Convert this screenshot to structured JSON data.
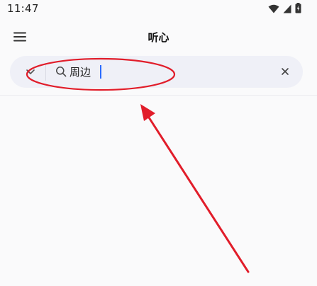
{
  "status_bar": {
    "time": "11:47",
    "icons": [
      "wifi-icon",
      "cellular-signal-icon",
      "battery-charging-icon"
    ]
  },
  "app_bar": {
    "title": "听心",
    "menu_icon": "hamburger-menu-icon"
  },
  "search": {
    "value": "周边",
    "left_icon": "chevron-down-icon",
    "search_icon": "search-icon",
    "clear_icon": "close-icon"
  },
  "annotation": {
    "color": "#e11d2a",
    "shapes": [
      "ellipse-highlight",
      "arrow-pointer"
    ]
  }
}
